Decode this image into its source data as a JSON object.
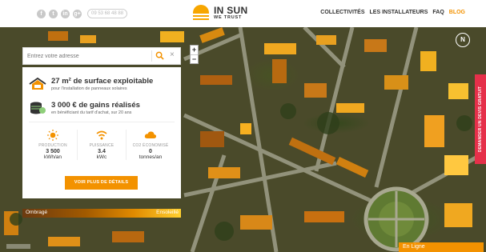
{
  "header": {
    "socials": [
      {
        "name": "facebook-icon",
        "glyph": "f"
      },
      {
        "name": "twitter-icon",
        "glyph": "t"
      },
      {
        "name": "linkedin-icon",
        "glyph": "in"
      },
      {
        "name": "google-plus-icon",
        "glyph": "g+"
      }
    ],
    "phone": "09 53 68 48 88",
    "logo_line1": "IN SUN",
    "logo_line2": "WE TRUST",
    "nav": {
      "collectivites": "COLLECTIVITÉS",
      "installateurs": "LES INSTALLATEURS",
      "faq": "FAQ",
      "blog": "BLOG"
    }
  },
  "map": {
    "zoom_in": "+",
    "zoom_out": "−",
    "compass": "N"
  },
  "search": {
    "placeholder": "Entrez votre adresse",
    "search_icon": "search-icon",
    "clear": "×"
  },
  "panel": {
    "surface_title": "27 m² de surface exploitable",
    "surface_sub": "pour l'installation de panneaux solaires",
    "gains_title": "3 000 € de gains réalisés",
    "gains_sub": "en bénéficiant du tarif d'achat, sur 20 ans",
    "stats": [
      {
        "label": "PRODUCTION",
        "value": "3 500",
        "unit": "kWh/an"
      },
      {
        "label": "PUISSANCE",
        "value": "3.4",
        "unit": "kWc"
      },
      {
        "label": "CO2 ÉCONOMISÉ",
        "value": "0",
        "unit": "tonnes/an"
      }
    ],
    "details_button": "VOIR PLUS DE DÉTAILS"
  },
  "legend": {
    "left": "Ombragé",
    "right": "Ensoleillé"
  },
  "side_tab": "DEMANDER UN DEVIS GRATUIT",
  "chat": "En Ligne",
  "colors": {
    "accent": "#f39200",
    "side_tab": "#e5304a"
  }
}
